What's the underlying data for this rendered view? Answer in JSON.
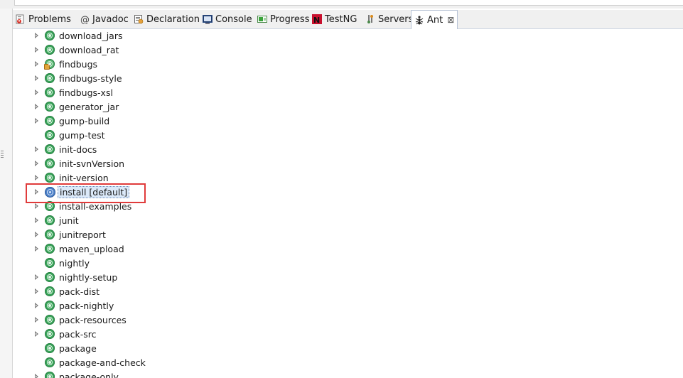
{
  "tabs": [
    {
      "id": "problems",
      "label": "Problems",
      "icon": "problems-icon"
    },
    {
      "id": "javadoc",
      "label": "Javadoc",
      "icon": "at-icon"
    },
    {
      "id": "declaration",
      "label": "Declaration",
      "icon": "declaration-icon"
    },
    {
      "id": "console",
      "label": "Console",
      "icon": "console-icon"
    },
    {
      "id": "progress",
      "label": "Progress",
      "icon": "progress-icon"
    },
    {
      "id": "testng",
      "label": "TestNG",
      "icon": "testng-icon"
    },
    {
      "id": "servers",
      "label": "Servers",
      "icon": "servers-icon"
    },
    {
      "id": "ant",
      "label": "Ant",
      "icon": "ant-icon",
      "active": true,
      "close": "⊠"
    }
  ],
  "targets": [
    {
      "label": "download_jars",
      "expandable": true,
      "type": "public"
    },
    {
      "label": "download_rat",
      "expandable": true,
      "type": "public"
    },
    {
      "label": "findbugs",
      "expandable": true,
      "type": "private"
    },
    {
      "label": "findbugs-style",
      "expandable": true,
      "type": "public"
    },
    {
      "label": "findbugs-xsl",
      "expandable": true,
      "type": "public"
    },
    {
      "label": "generator_jar",
      "expandable": true,
      "type": "public"
    },
    {
      "label": "gump-build",
      "expandable": true,
      "type": "public"
    },
    {
      "label": "gump-test",
      "expandable": false,
      "type": "public"
    },
    {
      "label": "init-docs",
      "expandable": true,
      "type": "public"
    },
    {
      "label": "init-svnVersion",
      "expandable": true,
      "type": "public"
    },
    {
      "label": "init-version",
      "expandable": true,
      "type": "public"
    },
    {
      "label": "install [default]",
      "expandable": true,
      "type": "default",
      "selected": true
    },
    {
      "label": "install-examples",
      "expandable": true,
      "type": "public"
    },
    {
      "label": "junit",
      "expandable": true,
      "type": "public"
    },
    {
      "label": "junitreport",
      "expandable": true,
      "type": "public"
    },
    {
      "label": "maven_upload",
      "expandable": true,
      "type": "public"
    },
    {
      "label": "nightly",
      "expandable": false,
      "type": "public"
    },
    {
      "label": "nightly-setup",
      "expandable": true,
      "type": "public"
    },
    {
      "label": "pack-dist",
      "expandable": true,
      "type": "public"
    },
    {
      "label": "pack-nightly",
      "expandable": true,
      "type": "public"
    },
    {
      "label": "pack-resources",
      "expandable": true,
      "type": "public"
    },
    {
      "label": "pack-src",
      "expandable": true,
      "type": "public"
    },
    {
      "label": "package",
      "expandable": false,
      "type": "public"
    },
    {
      "label": "package-and-check",
      "expandable": false,
      "type": "public"
    },
    {
      "label": "package-only",
      "expandable": true,
      "type": "public"
    }
  ],
  "colors": {
    "highlight": "#e03b3b",
    "selection": "#dbe9f9",
    "target": "#3aa55a",
    "default_target": "#4c80c8"
  }
}
